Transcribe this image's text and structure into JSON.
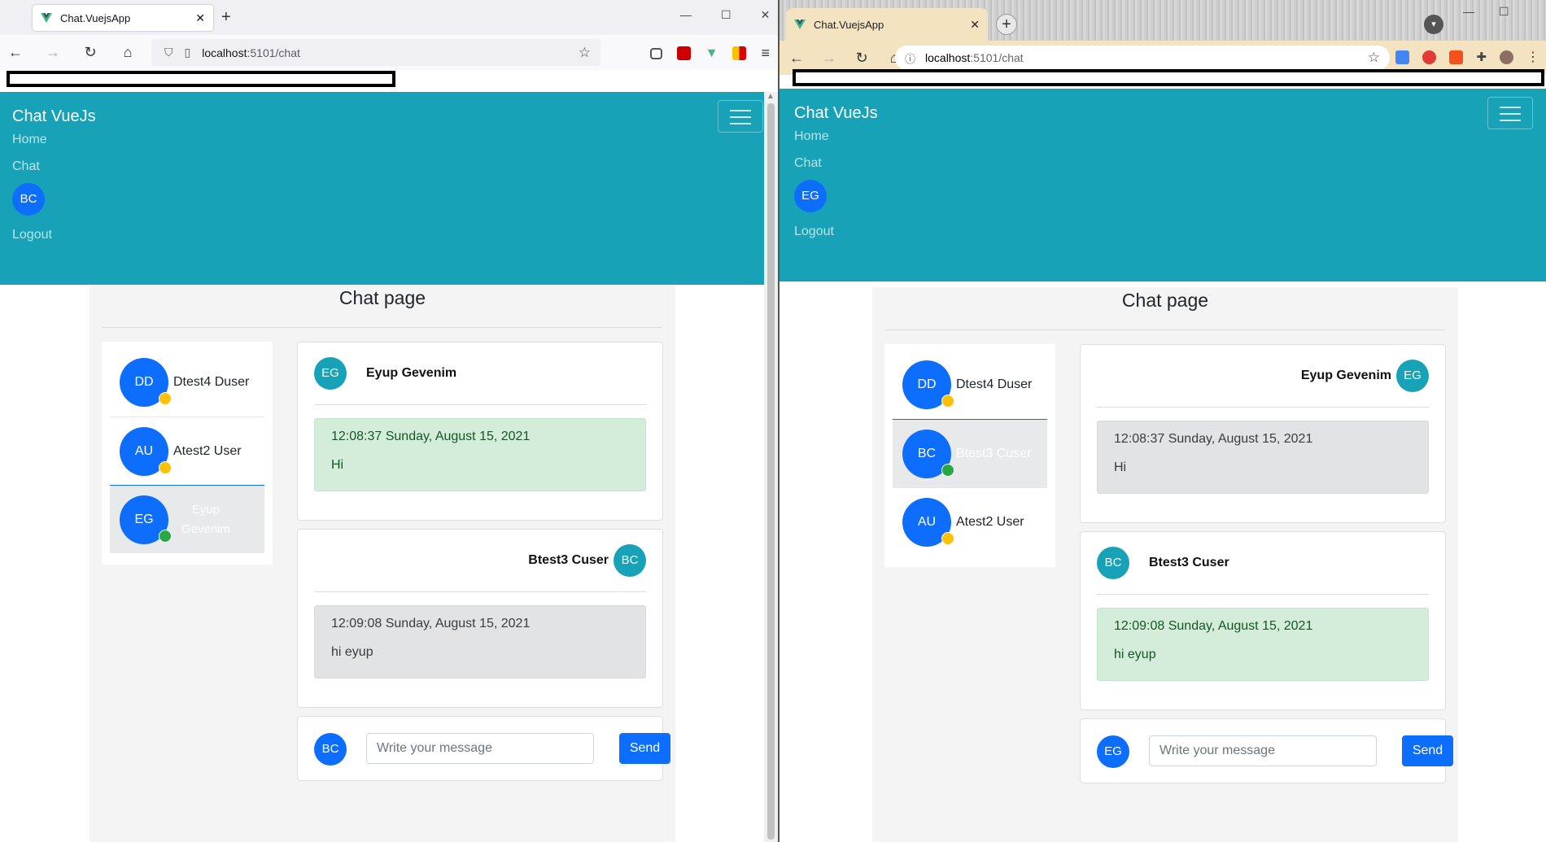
{
  "left_window": {
    "browser": {
      "tab_title": "Chat.VuejsApp",
      "url_host": "localhost",
      "url_path": ":5101/chat"
    },
    "app": {
      "brand": "Chat VueJs",
      "nav_home": "Home",
      "nav_chat": "Chat",
      "nav_avatar": "BC",
      "nav_logout": "Logout",
      "page_title": "Chat page",
      "users": [
        {
          "initials": "DD",
          "name": "Dtest4 Duser",
          "status": "away"
        },
        {
          "initials": "AU",
          "name": "Atest2 User",
          "status": "away"
        },
        {
          "initials": "EG",
          "name": "Eyup Gevenim",
          "status": "online",
          "active": true
        }
      ],
      "messages": [
        {
          "initials": "EG",
          "sender": "Eyup Gevenim",
          "align": "left",
          "timestamp": "12:08:37 Sunday, August 15, 2021",
          "text": "Hi",
          "style": "green"
        },
        {
          "initials": "BC",
          "sender": "Btest3 Cuser",
          "align": "right",
          "timestamp": "12:09:08 Sunday, August 15, 2021",
          "text": "hi eyup",
          "style": "grey"
        }
      ],
      "compose": {
        "initials": "BC",
        "placeholder": "Write your message",
        "send_label": "Send"
      }
    }
  },
  "right_window": {
    "browser": {
      "tab_title": "Chat.VuejsApp",
      "url_host": "localhost",
      "url_path": ":5101/chat"
    },
    "app": {
      "brand": "Chat VueJs",
      "nav_home": "Home",
      "nav_chat": "Chat",
      "nav_avatar": "EG",
      "nav_logout": "Logout",
      "page_title": "Chat page",
      "users": [
        {
          "initials": "DD",
          "name": "Dtest4 Duser",
          "status": "away"
        },
        {
          "initials": "BC",
          "name": "Btest3 Cuser",
          "status": "online",
          "active": true
        },
        {
          "initials": "AU",
          "name": "Atest2 User",
          "status": "away"
        }
      ],
      "messages": [
        {
          "initials": "EG",
          "sender": "Eyup Gevenim",
          "align": "right",
          "timestamp": "12:08:37 Sunday, August 15, 2021",
          "text": "Hi",
          "style": "grey"
        },
        {
          "initials": "BC",
          "sender": "Btest3 Cuser",
          "align": "left",
          "timestamp": "12:09:08 Sunday, August 15, 2021",
          "text": "hi eyup",
          "style": "green"
        }
      ],
      "compose": {
        "initials": "EG",
        "placeholder": "Write your message",
        "send_label": "Send"
      }
    }
  },
  "colors": {
    "navbar": "#17a2b8",
    "primary": "#0d6efd",
    "status_online": "#28a745",
    "status_away": "#ffc107"
  }
}
